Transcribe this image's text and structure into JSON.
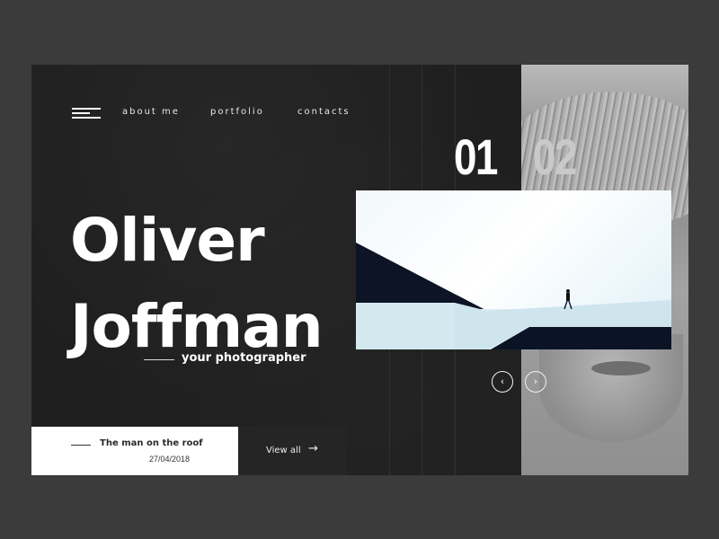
{
  "nav": {
    "menu_icon": "hamburger-menu-icon",
    "items": [
      {
        "label": "about me"
      },
      {
        "label": "portfolio"
      },
      {
        "label": "contacts"
      }
    ]
  },
  "hero": {
    "first_name": "Oliver",
    "last_name": "Joffman",
    "subtitle": "your photographer"
  },
  "slider": {
    "current": "01",
    "next": "02",
    "prev_icon": "‹",
    "next_icon": "›"
  },
  "featured": {
    "title": "The man on the roof",
    "date": "27/04/2018",
    "view_all_label": "View all",
    "view_all_icon": "→"
  },
  "colors": {
    "background": "#3b3b3b",
    "panel": "#1e1e1e",
    "accent_white": "#ffffff",
    "muted_number": "#c9c9c9"
  }
}
